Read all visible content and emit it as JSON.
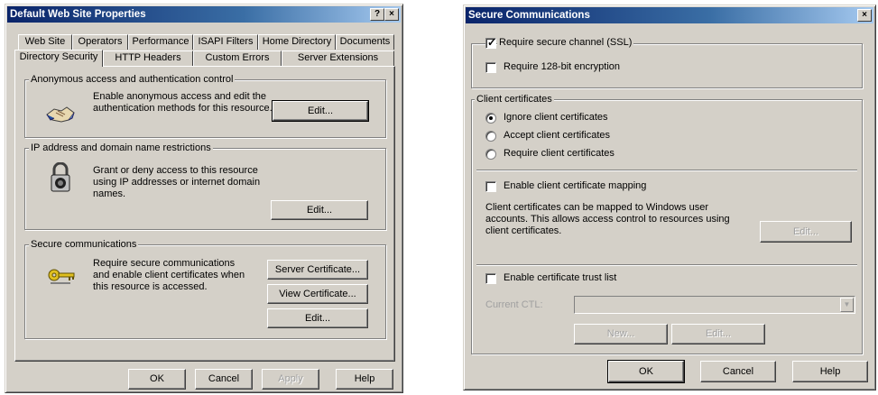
{
  "left": {
    "title": "Default Web Site Properties",
    "title_buttons": {
      "help": "?",
      "close": "×"
    },
    "tabs_row1": [
      "Web Site",
      "Operators",
      "Performance",
      "ISAPI Filters",
      "Home Directory",
      "Documents"
    ],
    "tabs_row2": [
      "Directory Security",
      "HTTP Headers",
      "Custom Errors",
      "Server Extensions"
    ],
    "anon": {
      "group_label": "Anonymous access and authentication control",
      "text": "Enable anonymous access and edit the authentication methods for this resource.",
      "edit": "Edit...",
      "icon": "handshake-icon"
    },
    "ip": {
      "group_label": "IP address and domain name restrictions",
      "text": "Grant or deny access to this resource using IP addresses or internet domain names.",
      "edit": "Edit...",
      "icon": "padlock-icon"
    },
    "secure": {
      "group_label": "Secure communications",
      "text": "Require secure communications and enable client certificates when this resource is accessed.",
      "server_cert": "Server Certificate...",
      "view_cert": "View Certificate...",
      "edit": "Edit...",
      "icon": "key-icon"
    },
    "buttons": {
      "ok": "OK",
      "cancel": "Cancel",
      "apply": "Apply",
      "help": "Help"
    }
  },
  "right": {
    "title": "Secure Communications",
    "title_buttons": {
      "close": "×"
    },
    "require_ssl": {
      "label": "Require secure channel (SSL)",
      "checked": true
    },
    "require_128": {
      "label": "Require 128-bit encryption",
      "checked": false
    },
    "client_certs": {
      "group_label": "Client certificates",
      "options": [
        "Ignore client certificates",
        "Accept client certificates",
        "Require client certificates"
      ],
      "selected": 0
    },
    "mapping": {
      "label": "Enable client certificate mapping",
      "checked": false,
      "text": "Client certificates can be mapped to Windows user accounts.  This allows access control to resources using client certificates.",
      "edit": "Edit..."
    },
    "ctl": {
      "label": "Enable certificate trust list",
      "checked": false,
      "current_label": "Current CTL:",
      "current_value": "",
      "new": "New...",
      "edit": "Edit..."
    },
    "buttons": {
      "ok": "OK",
      "cancel": "Cancel",
      "help": "Help"
    }
  }
}
